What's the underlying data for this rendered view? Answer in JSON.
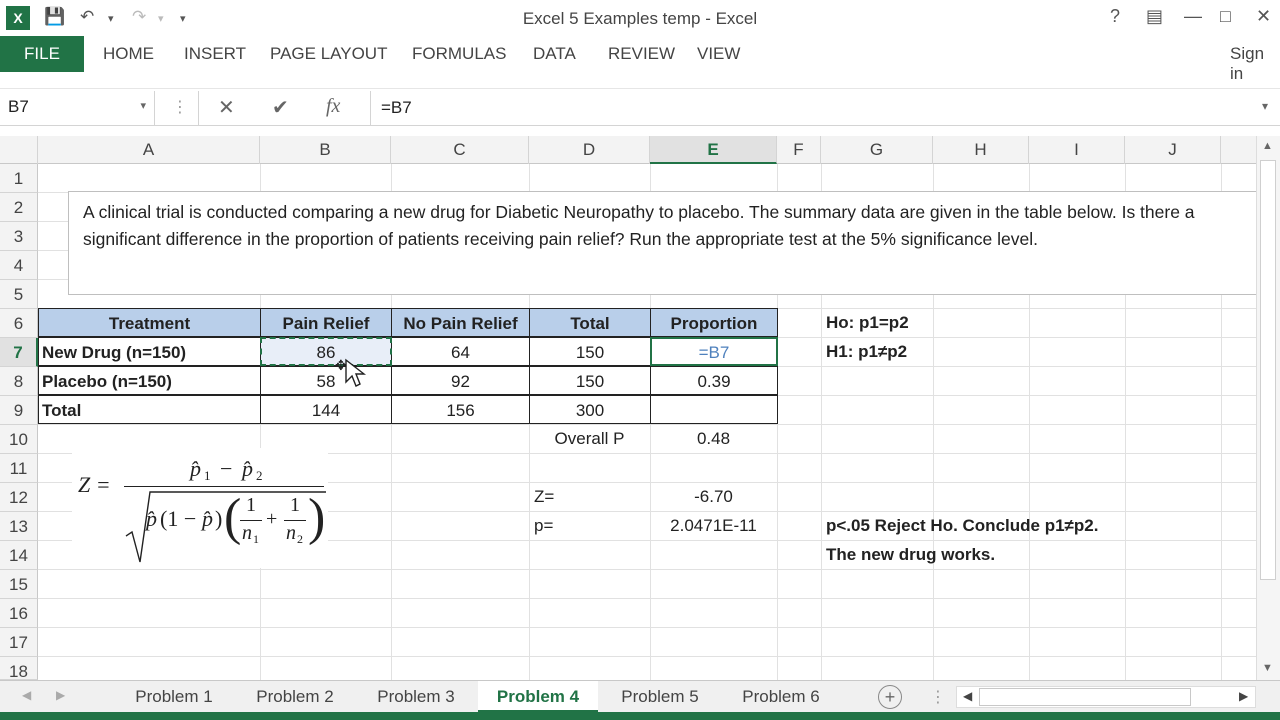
{
  "window": {
    "title": "Excel 5 Examples temp - Excel",
    "help": "?",
    "sign_in": "Sign in"
  },
  "ribbon": {
    "file": "FILE",
    "tabs": [
      "HOME",
      "INSERT",
      "PAGE LAYOUT",
      "FORMULAS",
      "DATA",
      "REVIEW",
      "VIEW"
    ]
  },
  "formula_bar": {
    "name_box": "B7",
    "fx": "fx",
    "formula": "=B7"
  },
  "columns": [
    "A",
    "B",
    "C",
    "D",
    "E",
    "F",
    "G",
    "H",
    "I",
    "J"
  ],
  "rows": [
    "1",
    "2",
    "3",
    "4",
    "5",
    "6",
    "7",
    "8",
    "9",
    "10",
    "11",
    "12",
    "13",
    "14",
    "15",
    "16",
    "17",
    "18"
  ],
  "problem_text": "A clinical trial is conducted comparing a new drug for Diabetic Neuropathy to placebo. The summary data are given in the table below. Is there a significant difference in the proportion of patients receiving pain relief? Run the appropriate test at the 5% significance level.",
  "table": {
    "headers": [
      "Treatment",
      "Pain Relief",
      "No Pain Relief",
      "Total",
      "Proportion"
    ],
    "rows": [
      [
        "New Drug (n=150)",
        "86",
        "64",
        "150",
        "=B7"
      ],
      [
        "Placebo (n=150)",
        "58",
        "92",
        "150",
        "0.39"
      ],
      [
        "Total",
        "144",
        "156",
        "300",
        ""
      ]
    ]
  },
  "stats": {
    "overall_label": "Overall P",
    "overall_value": "0.48",
    "z_label": "Z=",
    "z_value": "-6.70",
    "p_label": "p=",
    "p_value": "2.0471E-11"
  },
  "hypotheses": {
    "h0": "Ho: p1=p2",
    "h1": "H1: p1≠p2",
    "conclusion1": "p<.05 Reject Ho.  Conclude p1≠p2.",
    "conclusion2": "The new drug works."
  },
  "formula_image": {
    "z": "Z =",
    "p1": "p̂",
    "sub1": "1",
    "minus": "−",
    "p2": "p̂",
    "sub2": "2",
    "phat": "p̂",
    "one_minus": "(1 − ",
    "close": ")",
    "one": "1",
    "n1": "n",
    "n1sub": "1",
    "plus": "+",
    "n2": "n",
    "n2sub": "2"
  },
  "sheets": [
    "Problem 1",
    "Problem 2",
    "Problem 3",
    "Problem 4",
    "Problem 5",
    "Problem 6"
  ],
  "active_sheet": "Problem 4",
  "colors": {
    "accent": "#217346",
    "header_fill": "#b9cfea",
    "selection": "#217346",
    "formula_ref": "#4f81bd"
  }
}
